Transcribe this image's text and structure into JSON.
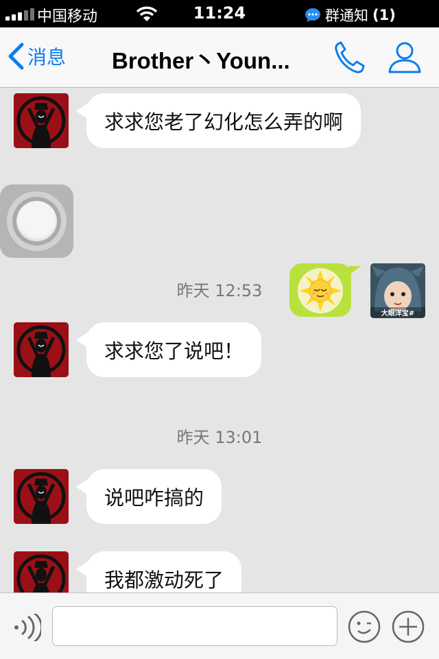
{
  "status": {
    "carrier": "中国移动",
    "time": "11:24",
    "notification_label": "群通知",
    "notification_count": "(1)"
  },
  "header": {
    "back_label": "消息",
    "title": "Brother丶Youn..."
  },
  "messages": [
    {
      "direction": "incoming",
      "text": "求求您老了幻化怎么弄的啊"
    },
    {
      "direction": "outgoing",
      "type": "sticker",
      "icon": "relieved-sun-face"
    },
    {
      "type": "timestamp",
      "text": "昨天 12:53"
    },
    {
      "direction": "incoming",
      "text": "求求您了说吧！"
    },
    {
      "type": "timestamp",
      "text": "昨天 13:01"
    },
    {
      "direction": "incoming",
      "text": "说吧咋搞的"
    },
    {
      "direction": "incoming",
      "text": "我都激动死了"
    }
  ],
  "my_avatar_caption": "大眼洋宝#",
  "composer": {
    "value": "",
    "placeholder": ""
  },
  "colors": {
    "accent": "#0a7cf0",
    "chat_bg": "#e5e5e5",
    "sticker": "#b9e13e"
  }
}
